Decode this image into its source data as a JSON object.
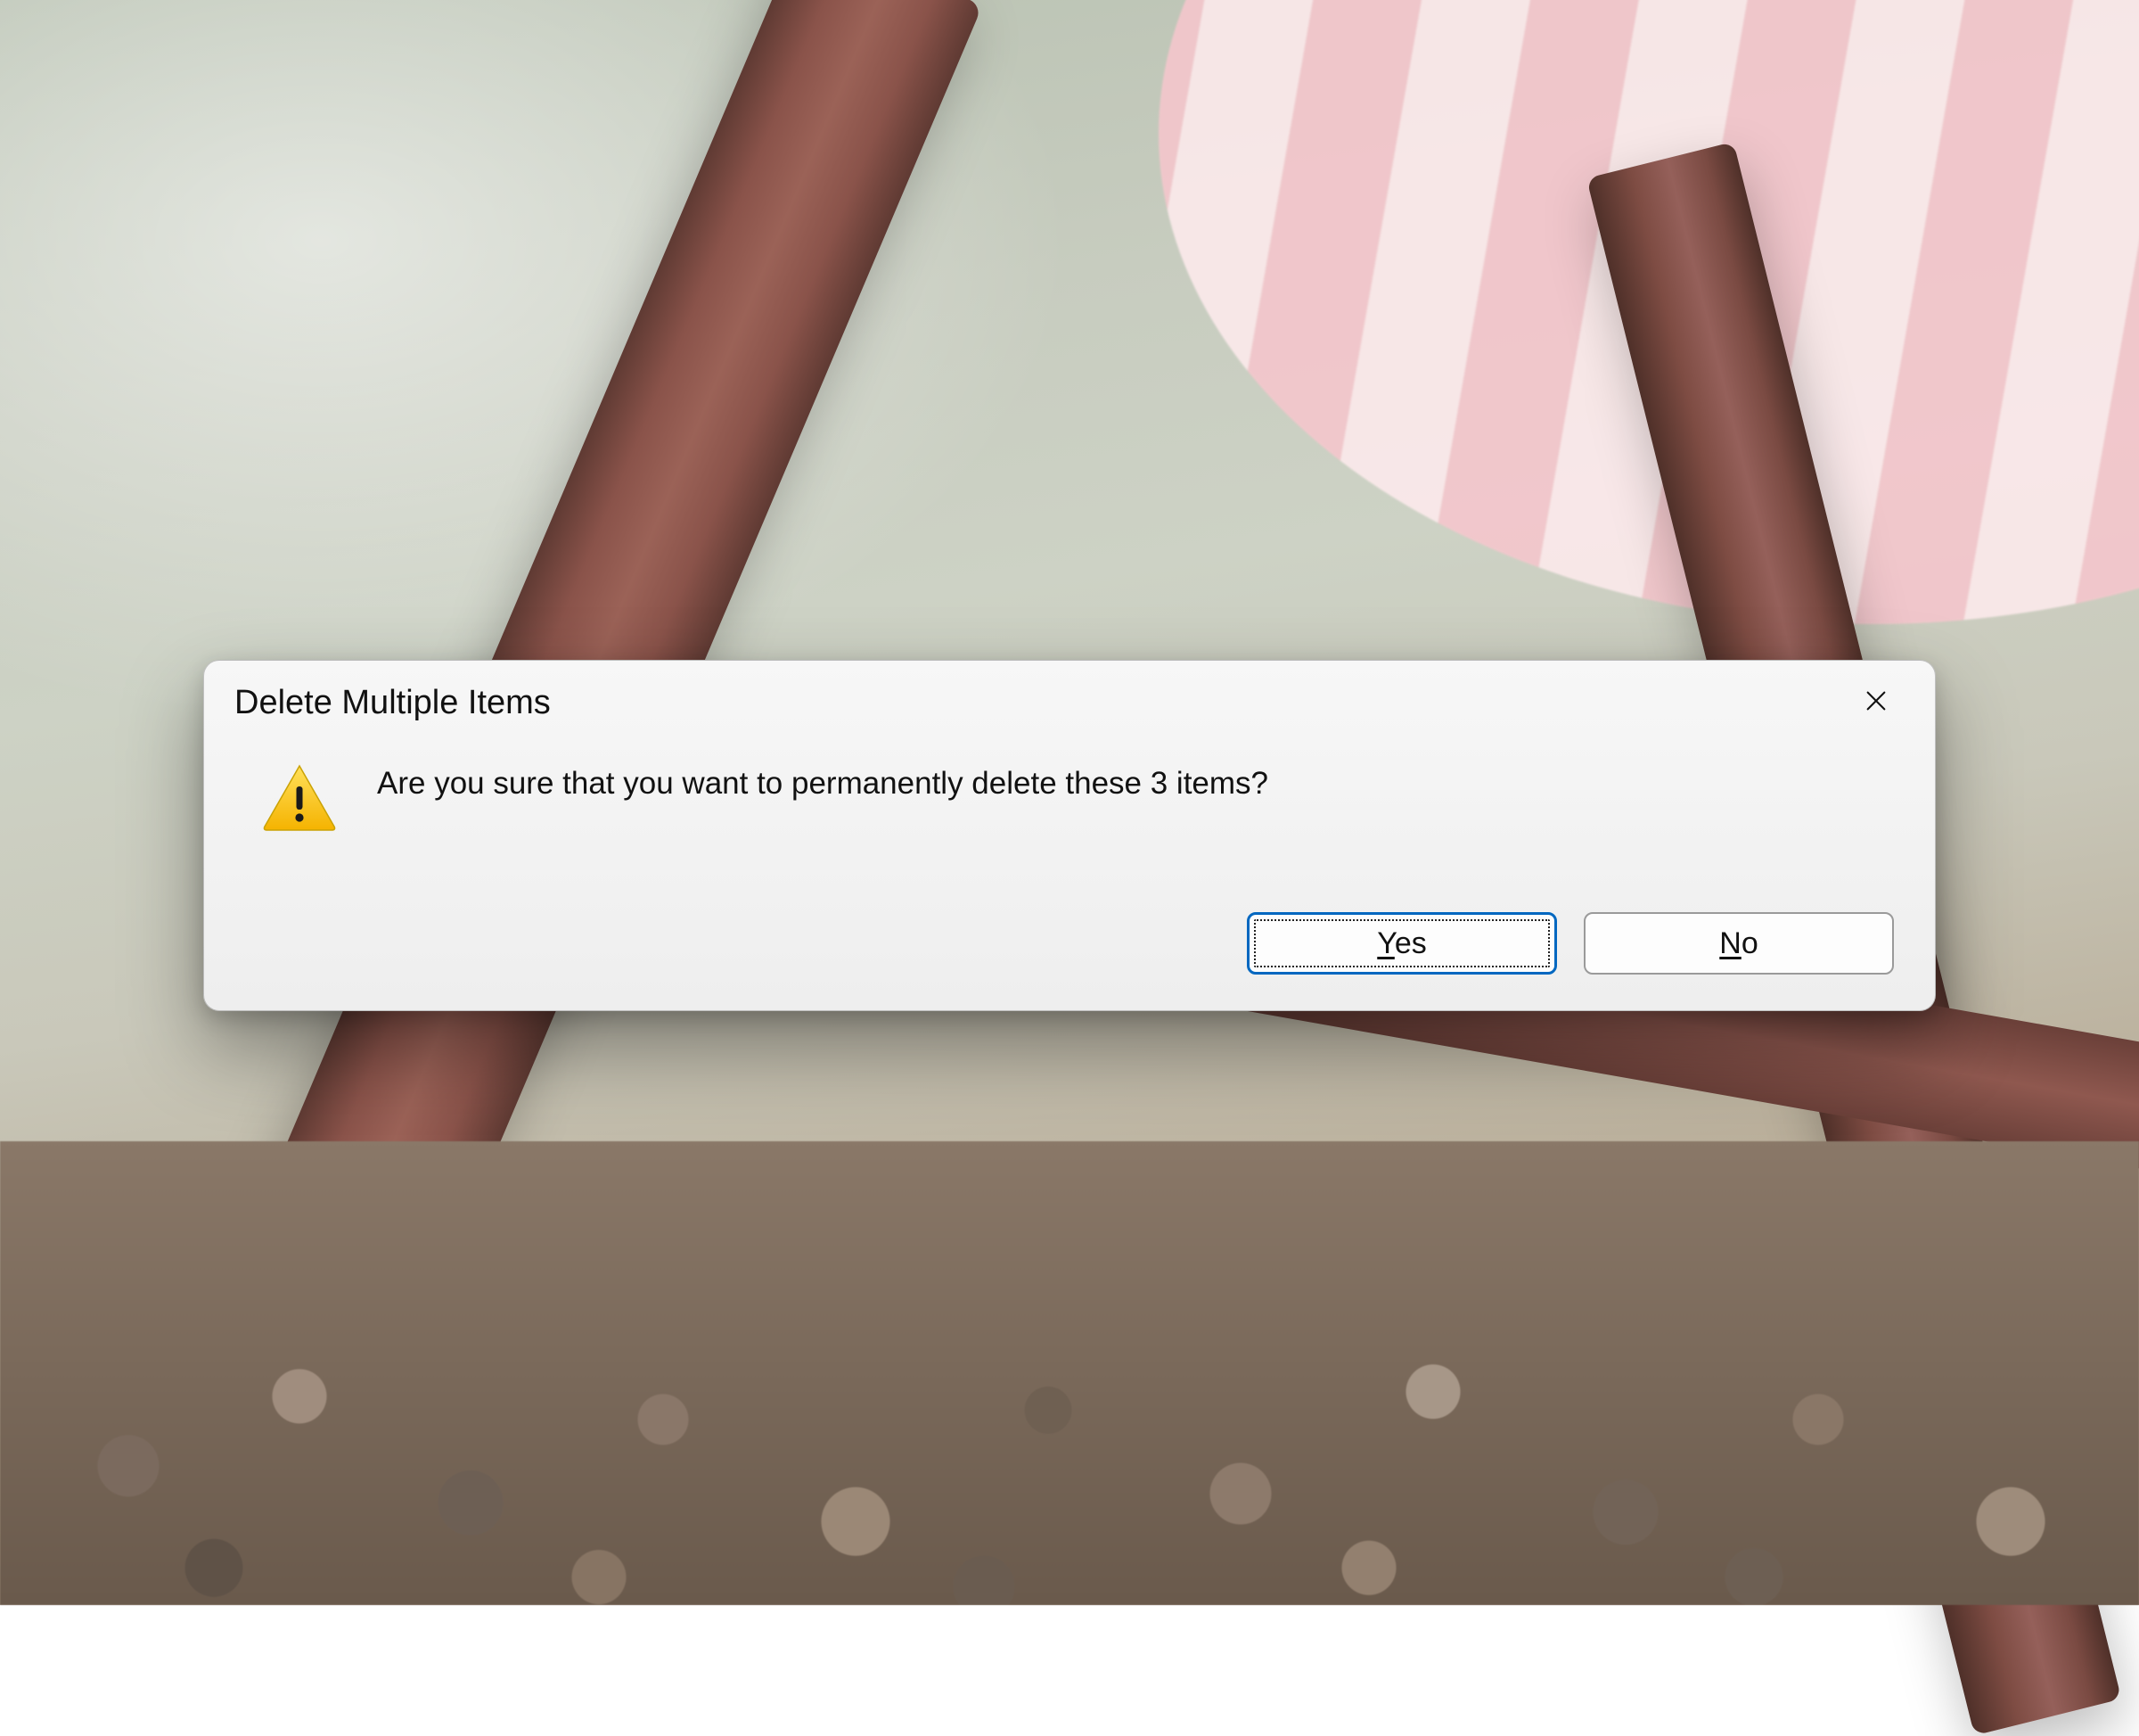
{
  "dialog": {
    "title": "Delete Multiple Items",
    "message": "Are you sure that you want to permanently delete these 3 items?",
    "buttons": {
      "yes_prefix": "Y",
      "yes_rest": "es",
      "no_prefix": "N",
      "no_rest": "o"
    }
  }
}
